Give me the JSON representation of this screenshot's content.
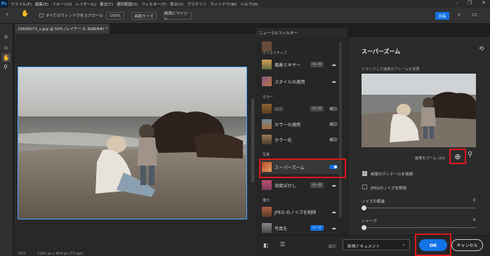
{
  "menubar": {
    "items": [
      "ファイル(F)",
      "編集(E)",
      "イメージ(I)",
      "レイヤー(L)",
      "書式(Y)",
      "選択範囲(S)",
      "フィルター(T)",
      "表示(V)",
      "プラグイン",
      "ウィンドウ(W)",
      "ヘルプ(H)"
    ]
  },
  "options": {
    "scroll_all": "すべてのウィンドウをスクロール",
    "zoom": "100%",
    "fit_screen": "画面サイズ",
    "fill_screen": "画面にフィット",
    "share": "共有"
  },
  "document": {
    "tab": "29936073_s.jpg @ 50% (レイヤー 0, RGB/8#) *",
    "zoom": "50%",
    "size": "1280 px x 854 px (72 ppi)"
  },
  "neural_filters": {
    "title": "ニューラルフィルター",
    "categories": {
      "creative": "クリエイティブ",
      "color": "カラー",
      "photo": "写真",
      "restore": "復元"
    },
    "filters": [
      {
        "label": "風景ミキサー",
        "beta": "ベータ"
      },
      {
        "label": "スタイルの適用"
      },
      {
        "label": "調和",
        "beta": "ベータ"
      },
      {
        "label": "カラーの適用"
      },
      {
        "label": "カラー化"
      },
      {
        "label": "スーパーズーム"
      },
      {
        "label": "深度ぼかし",
        "beta": "ベータ"
      },
      {
        "label": "JPEG のノイズを削除"
      },
      {
        "label": "写真を",
        "beta": "ベータ"
      }
    ]
  },
  "superzoom": {
    "title": "スーパーズーム",
    "hint": "ドラッグして画像のフレームを変更",
    "zoom_label": "画像をズーム (2x)",
    "enhance_detail": "画像のディテールを強調",
    "remove_jpeg": "JPEGのノイズを削除",
    "noise": "ノイズの軽減",
    "noise_value": "0",
    "sharpen": "シャープ",
    "sharpen_value": "0"
  },
  "footer": {
    "output_label": "出力",
    "output_value": "新規ドキュメント",
    "ok": "OK",
    "cancel": "キャンセル"
  },
  "colors": {
    "accent": "#1473e6",
    "highlight": "#e0161e"
  }
}
